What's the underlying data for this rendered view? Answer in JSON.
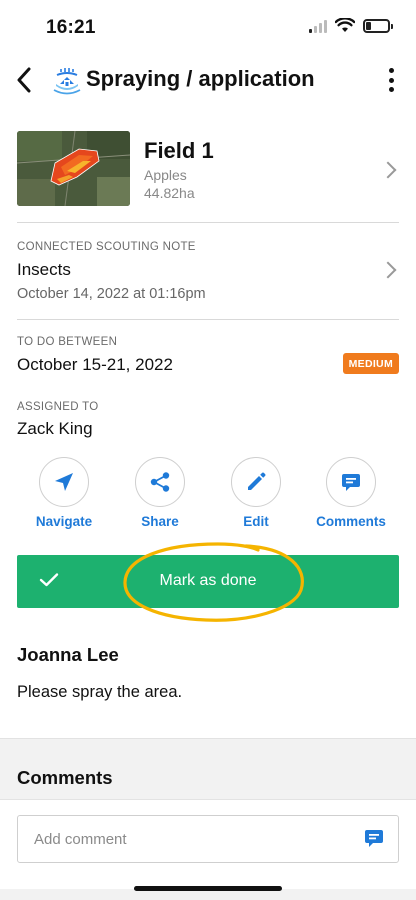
{
  "status_bar": {
    "time": "16:21"
  },
  "header": {
    "title": "Spraying / application",
    "icon": "spraying-icon"
  },
  "field": {
    "name": "Field 1",
    "crop": "Apples",
    "area": "44.82ha"
  },
  "scouting": {
    "label": "CONNECTED SCOUTING NOTE",
    "title": "Insects",
    "date": "October 14, 2022 at 01:16pm"
  },
  "schedule": {
    "label": "TO DO BETWEEN",
    "range": "October 15-21, 2022",
    "priority": "MEDIUM",
    "priority_color": "#f07b1d"
  },
  "assignee": {
    "label": "ASSIGNED TO",
    "name": "Zack King"
  },
  "actions": [
    {
      "label": "Navigate",
      "icon": "navigate-icon"
    },
    {
      "label": "Share",
      "icon": "share-icon"
    },
    {
      "label": "Edit",
      "icon": "edit-icon"
    },
    {
      "label": "Comments",
      "icon": "comments-icon"
    }
  ],
  "done_button": {
    "label": "Mark as done",
    "color": "#1db16f"
  },
  "note": {
    "author": "Joanna Lee",
    "text": "Please spray the area."
  },
  "comments": {
    "title": "Comments",
    "placeholder": "Add comment"
  },
  "colors": {
    "accent": "#1f7ad8",
    "highlight": "#f5b400"
  }
}
